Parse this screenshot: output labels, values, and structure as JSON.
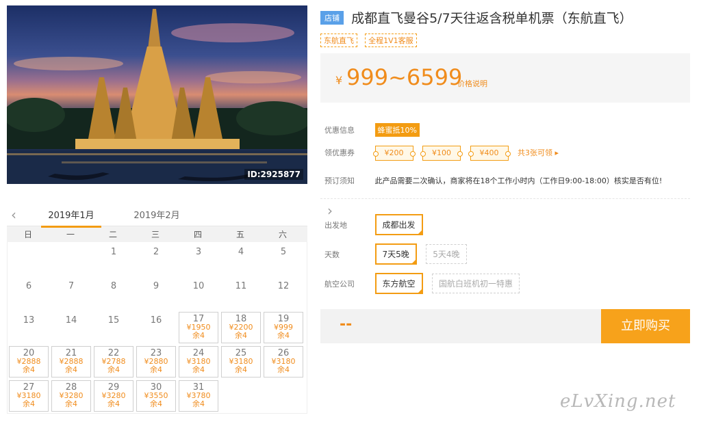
{
  "hero": {
    "id_label": "ID:2925877"
  },
  "calendar": {
    "prev_icon": "chevron-left",
    "next_icon": "chevron-right",
    "months": [
      "2019年1月",
      "2019年2月"
    ],
    "weekdays": [
      "日",
      "一",
      "二",
      "三",
      "四",
      "五",
      "六"
    ],
    "leading_blank": 2,
    "days": [
      {
        "d": "1"
      },
      {
        "d": "2"
      },
      {
        "d": "3"
      },
      {
        "d": "4"
      },
      {
        "d": "5"
      },
      {
        "d": "6"
      },
      {
        "d": "7"
      },
      {
        "d": "8"
      },
      {
        "d": "9"
      },
      {
        "d": "10"
      },
      {
        "d": "11"
      },
      {
        "d": "12"
      },
      {
        "d": "13"
      },
      {
        "d": "14"
      },
      {
        "d": "15"
      },
      {
        "d": "16"
      },
      {
        "d": "17",
        "price": "¥1950",
        "stock": "余4"
      },
      {
        "d": "18",
        "price": "¥2200",
        "stock": "余4"
      },
      {
        "d": "19",
        "price": "¥999",
        "stock": "余4"
      },
      {
        "d": "20",
        "price": "¥2888",
        "stock": "余4"
      },
      {
        "d": "21",
        "price": "¥2888",
        "stock": "余4"
      },
      {
        "d": "22",
        "price": "¥2788",
        "stock": "余4"
      },
      {
        "d": "23",
        "price": "¥2880",
        "stock": "余4"
      },
      {
        "d": "24",
        "price": "¥3180",
        "stock": "余4"
      },
      {
        "d": "25",
        "price": "¥3180",
        "stock": "余4"
      },
      {
        "d": "26",
        "price": "¥3180",
        "stock": "余4"
      },
      {
        "d": "27",
        "price": "¥3180",
        "stock": "余4"
      },
      {
        "d": "28",
        "price": "¥3280",
        "stock": "余4"
      },
      {
        "d": "29",
        "price": "¥3280",
        "stock": "余4"
      },
      {
        "d": "30",
        "price": "¥3550",
        "stock": "余4"
      },
      {
        "d": "31",
        "price": "¥3780",
        "stock": "余4"
      }
    ]
  },
  "product": {
    "shop_badge": "店铺",
    "title": "成都直飞曼谷5/7天往返含税单机票（东航直飞）",
    "tags": [
      "东航直飞",
      "全程1V1客服"
    ],
    "price_currency": "¥",
    "price_range": "999~6599",
    "price_note": "价格说明",
    "promo_label": "优惠信息",
    "promo_badge": "蜂蜜抵10%",
    "coupon_label": "领优惠券",
    "coupons": [
      "¥200",
      "¥100",
      "¥400"
    ],
    "coupon_more": "共3张可领 ▸",
    "notice_label": "预订须知",
    "notice_text": "此产品需要二次确认，商家将在18个工作小时内（工作日9:00-18:00）核实是否有位!",
    "departure_label": "出发地",
    "departure_options": [
      {
        "label": "成都出发",
        "selected": true
      }
    ],
    "days_label": "天数",
    "days_options": [
      {
        "label": "7天5晚",
        "selected": true
      },
      {
        "label": "5天4晚",
        "selected": false
      }
    ],
    "airline_label": "航空公司",
    "airline_options": [
      {
        "label": "东方航空",
        "selected": true
      },
      {
        "label": "国航白班机初一特惠",
        "selected": false
      }
    ],
    "total_placeholder": "--",
    "buy_label": "立即购买"
  },
  "watermark": "eLvXing.net",
  "colors": {
    "accent": "#f39c12",
    "price": "#f08c1c",
    "shop_badge": "#5aa0e8"
  }
}
